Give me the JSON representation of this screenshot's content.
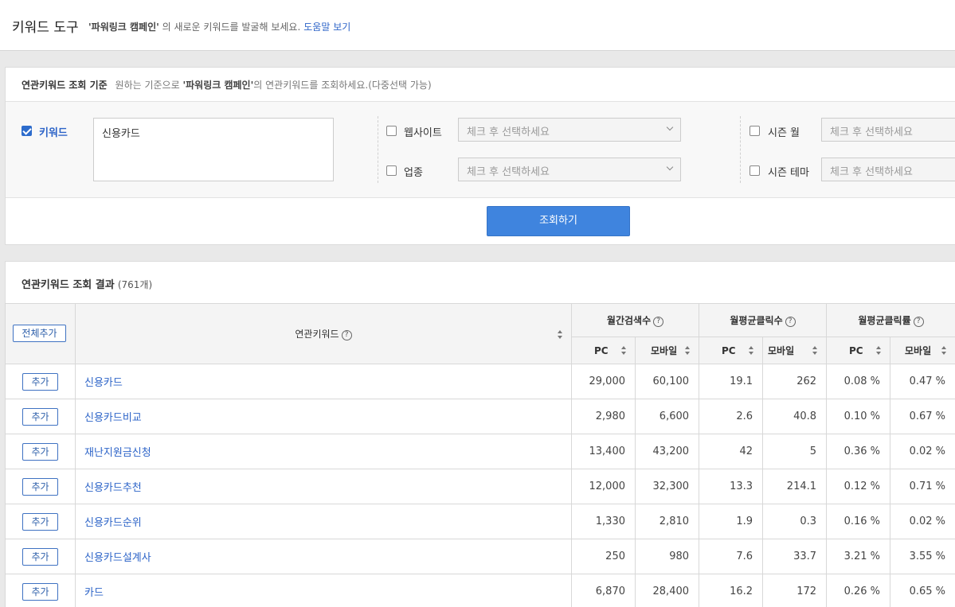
{
  "header": {
    "title": "키워드 도구",
    "desc_prefix": "'파워링크 캠페인'",
    "desc_suffix": " 의 새로운 키워드를 발굴해 보세요.",
    "help_link": "도움말 보기"
  },
  "criteria": {
    "label": "연관키워드 조회 기준",
    "desc_a": "원하는 기준으로 ",
    "desc_b": "'파워링크 캠페인'",
    "desc_c": "의 연관키워드를 조회하세요.(다중선택 가능)",
    "keyword": {
      "label": "키워드",
      "checked": true,
      "value": "신용카드"
    },
    "website": {
      "label": "웹사이트",
      "checked": false,
      "placeholder": "체크 후 선택하세요"
    },
    "industry": {
      "label": "업종",
      "checked": false,
      "placeholder": "체크 후 선택하세요"
    },
    "season_month": {
      "label": "시즌 월",
      "checked": false,
      "placeholder": "체크 후 선택하세요"
    },
    "season_theme": {
      "label": "시즌 테마",
      "checked": false,
      "placeholder": "체크 후 선택하세요"
    },
    "search_button": "조회하기"
  },
  "results": {
    "label": "연관키워드 조회 결과",
    "count": "(761개)",
    "add_all": "전체추가",
    "col_keyword": "연관키워드",
    "col_monthly_search": "월간검색수",
    "col_avg_clicks": "월평균클릭수",
    "col_avg_ctr": "월평균클릭률",
    "sub_pc": "PC",
    "sub_mobile": "모바일",
    "qm": "?",
    "add_label": "추가",
    "rows": [
      {
        "keyword": "신용카드",
        "search_pc": "29,000",
        "search_mo": "60,100",
        "click_pc": "19.1",
        "click_mo": "262",
        "ctr_pc": "0.08 %",
        "ctr_mo": "0.47 %"
      },
      {
        "keyword": "신용카드비교",
        "search_pc": "2,980",
        "search_mo": "6,600",
        "click_pc": "2.6",
        "click_mo": "40.8",
        "ctr_pc": "0.10 %",
        "ctr_mo": "0.67 %"
      },
      {
        "keyword": "재난지원금신청",
        "search_pc": "13,400",
        "search_mo": "43,200",
        "click_pc": "42",
        "click_mo": "5",
        "ctr_pc": "0.36 %",
        "ctr_mo": "0.02 %"
      },
      {
        "keyword": "신용카드추천",
        "search_pc": "12,000",
        "search_mo": "32,300",
        "click_pc": "13.3",
        "click_mo": "214.1",
        "ctr_pc": "0.12 %",
        "ctr_mo": "0.71 %"
      },
      {
        "keyword": "신용카드순위",
        "search_pc": "1,330",
        "search_mo": "2,810",
        "click_pc": "1.9",
        "click_mo": "0.3",
        "ctr_pc": "0.16 %",
        "ctr_mo": "0.02 %"
      },
      {
        "keyword": "신용카드설계사",
        "search_pc": "250",
        "search_mo": "980",
        "click_pc": "7.6",
        "click_mo": "33.7",
        "ctr_pc": "3.21 %",
        "ctr_mo": "3.55 %"
      },
      {
        "keyword": "카드",
        "search_pc": "6,870",
        "search_mo": "28,400",
        "click_pc": "16.2",
        "click_mo": "172",
        "ctr_pc": "0.26 %",
        "ctr_mo": "0.65 %"
      }
    ]
  }
}
